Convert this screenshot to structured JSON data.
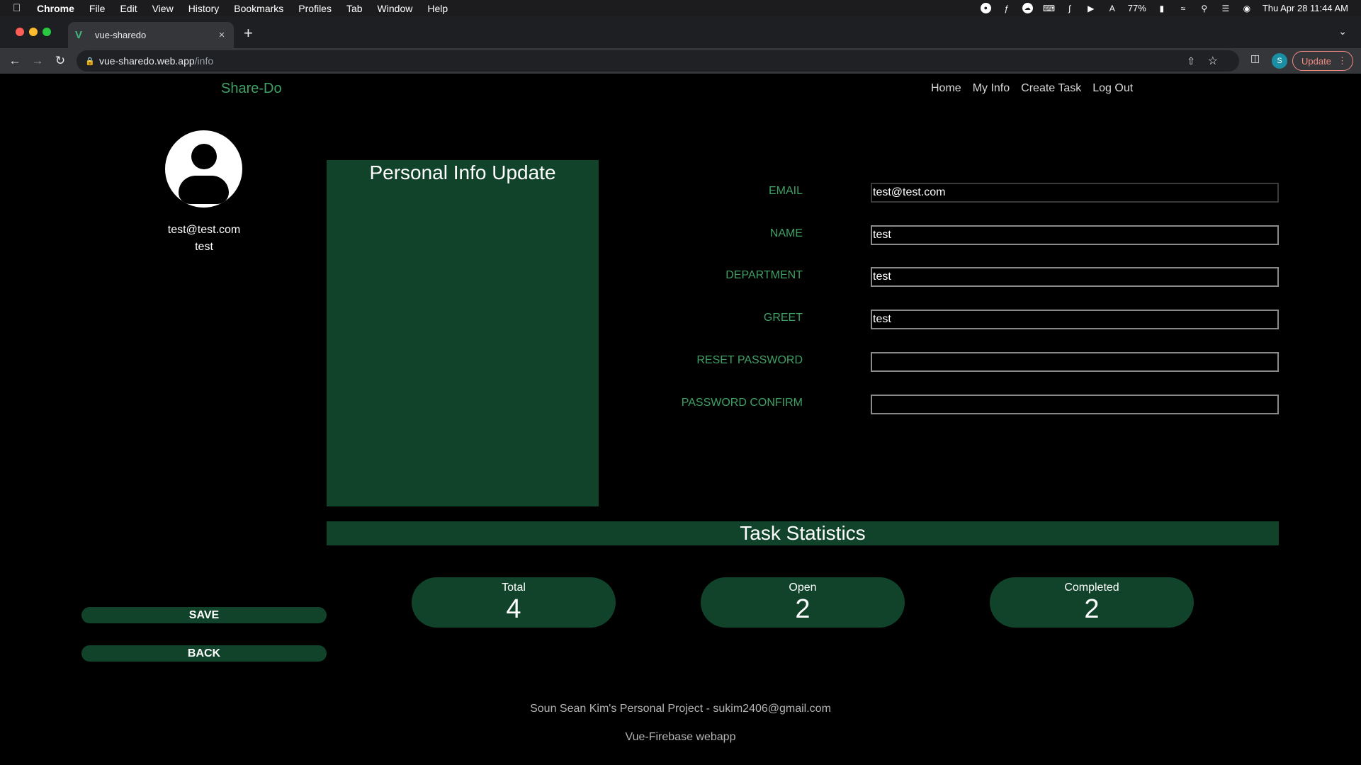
{
  "menubar": {
    "app": "Chrome",
    "items": [
      "File",
      "Edit",
      "View",
      "History",
      "Bookmarks",
      "Profiles",
      "Tab",
      "Window",
      "Help"
    ],
    "battery": "77%",
    "datetime": "Thu Apr 28  11:44 AM"
  },
  "browser": {
    "tab_title": "vue-sharedo",
    "url_host": "vue-sharedo.web.app",
    "url_path": "/info",
    "profile_initial": "S",
    "update_label": "Update"
  },
  "app": {
    "brand": "Share-Do",
    "nav": [
      "Home",
      "My Info",
      "Create Task",
      "Log Out"
    ]
  },
  "profile": {
    "email": "test@test.com",
    "name": "test"
  },
  "info_panel": {
    "title": "Personal Info Update"
  },
  "form": {
    "fields": [
      {
        "label": "EMAIL",
        "value": "test@test.com"
      },
      {
        "label": "NAME",
        "value": "test"
      },
      {
        "label": "DEPARTMENT",
        "value": "test"
      },
      {
        "label": "GREET",
        "value": "test"
      },
      {
        "label": "RESET PASSWORD",
        "value": ""
      },
      {
        "label": "PASSWORD CONFIRM",
        "value": ""
      }
    ]
  },
  "stats": {
    "title": "Task Statistics",
    "items": [
      {
        "label": "Total",
        "value": "4"
      },
      {
        "label": "Open",
        "value": "2"
      },
      {
        "label": "Completed",
        "value": "2"
      }
    ]
  },
  "buttons": {
    "save": "SAVE",
    "back": "BACK"
  },
  "footer": {
    "line1": "Soun Sean Kim's Personal Project - sukim2406@gmail.com",
    "line2": "Vue-Firebase webapp"
  },
  "colors": {
    "accent_green": "#3fa065",
    "panel_green": "#10432a",
    "background": "#000000"
  }
}
